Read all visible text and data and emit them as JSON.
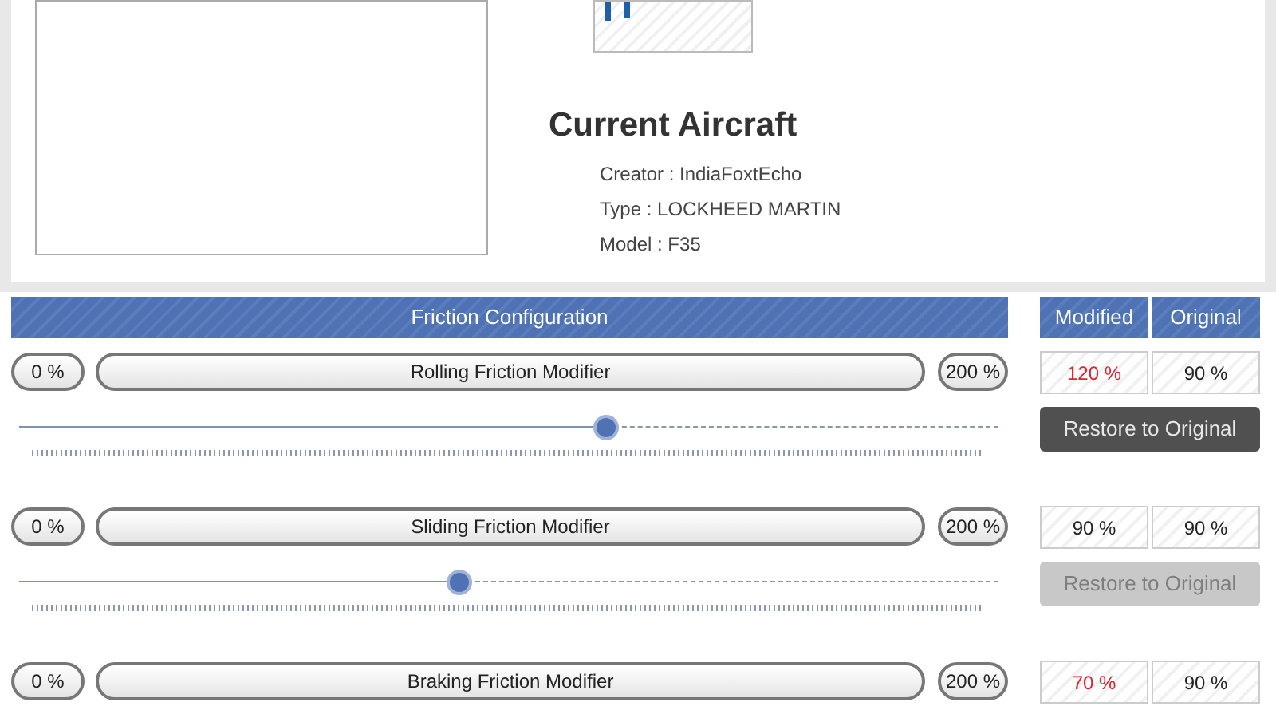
{
  "aircraft": {
    "heading": "Current Aircraft",
    "details": [
      "Creator : IndiaFoxtEcho",
      "Type : LOCKHEED MARTIN",
      "Model : F35"
    ]
  },
  "friction": {
    "title": "Friction Configuration",
    "columns": [
      "Modified",
      "Original"
    ],
    "rows": [
      {
        "min": "0 %",
        "label": "Rolling Friction Modifier",
        "max": "200 %",
        "level": 0.6,
        "modified_value": "120 %",
        "original_value": "90 %",
        "modified": true,
        "restore": {
          "label": "Restore to Original",
          "disabled": false
        }
      },
      {
        "min": "0 %",
        "label": "Sliding Friction Modifier",
        "max": "200 %",
        "level": 0.45,
        "modified_value": "90 %",
        "original_value": "90 %",
        "modified": false,
        "restore": {
          "label": "Restore to Original",
          "disabled": true
        }
      },
      {
        "min": "0 %",
        "label": "Braking Friction Modifier",
        "max": "200 %",
        "modified_value": "70 %",
        "original_value": "90 %",
        "modified": true
      }
    ]
  }
}
